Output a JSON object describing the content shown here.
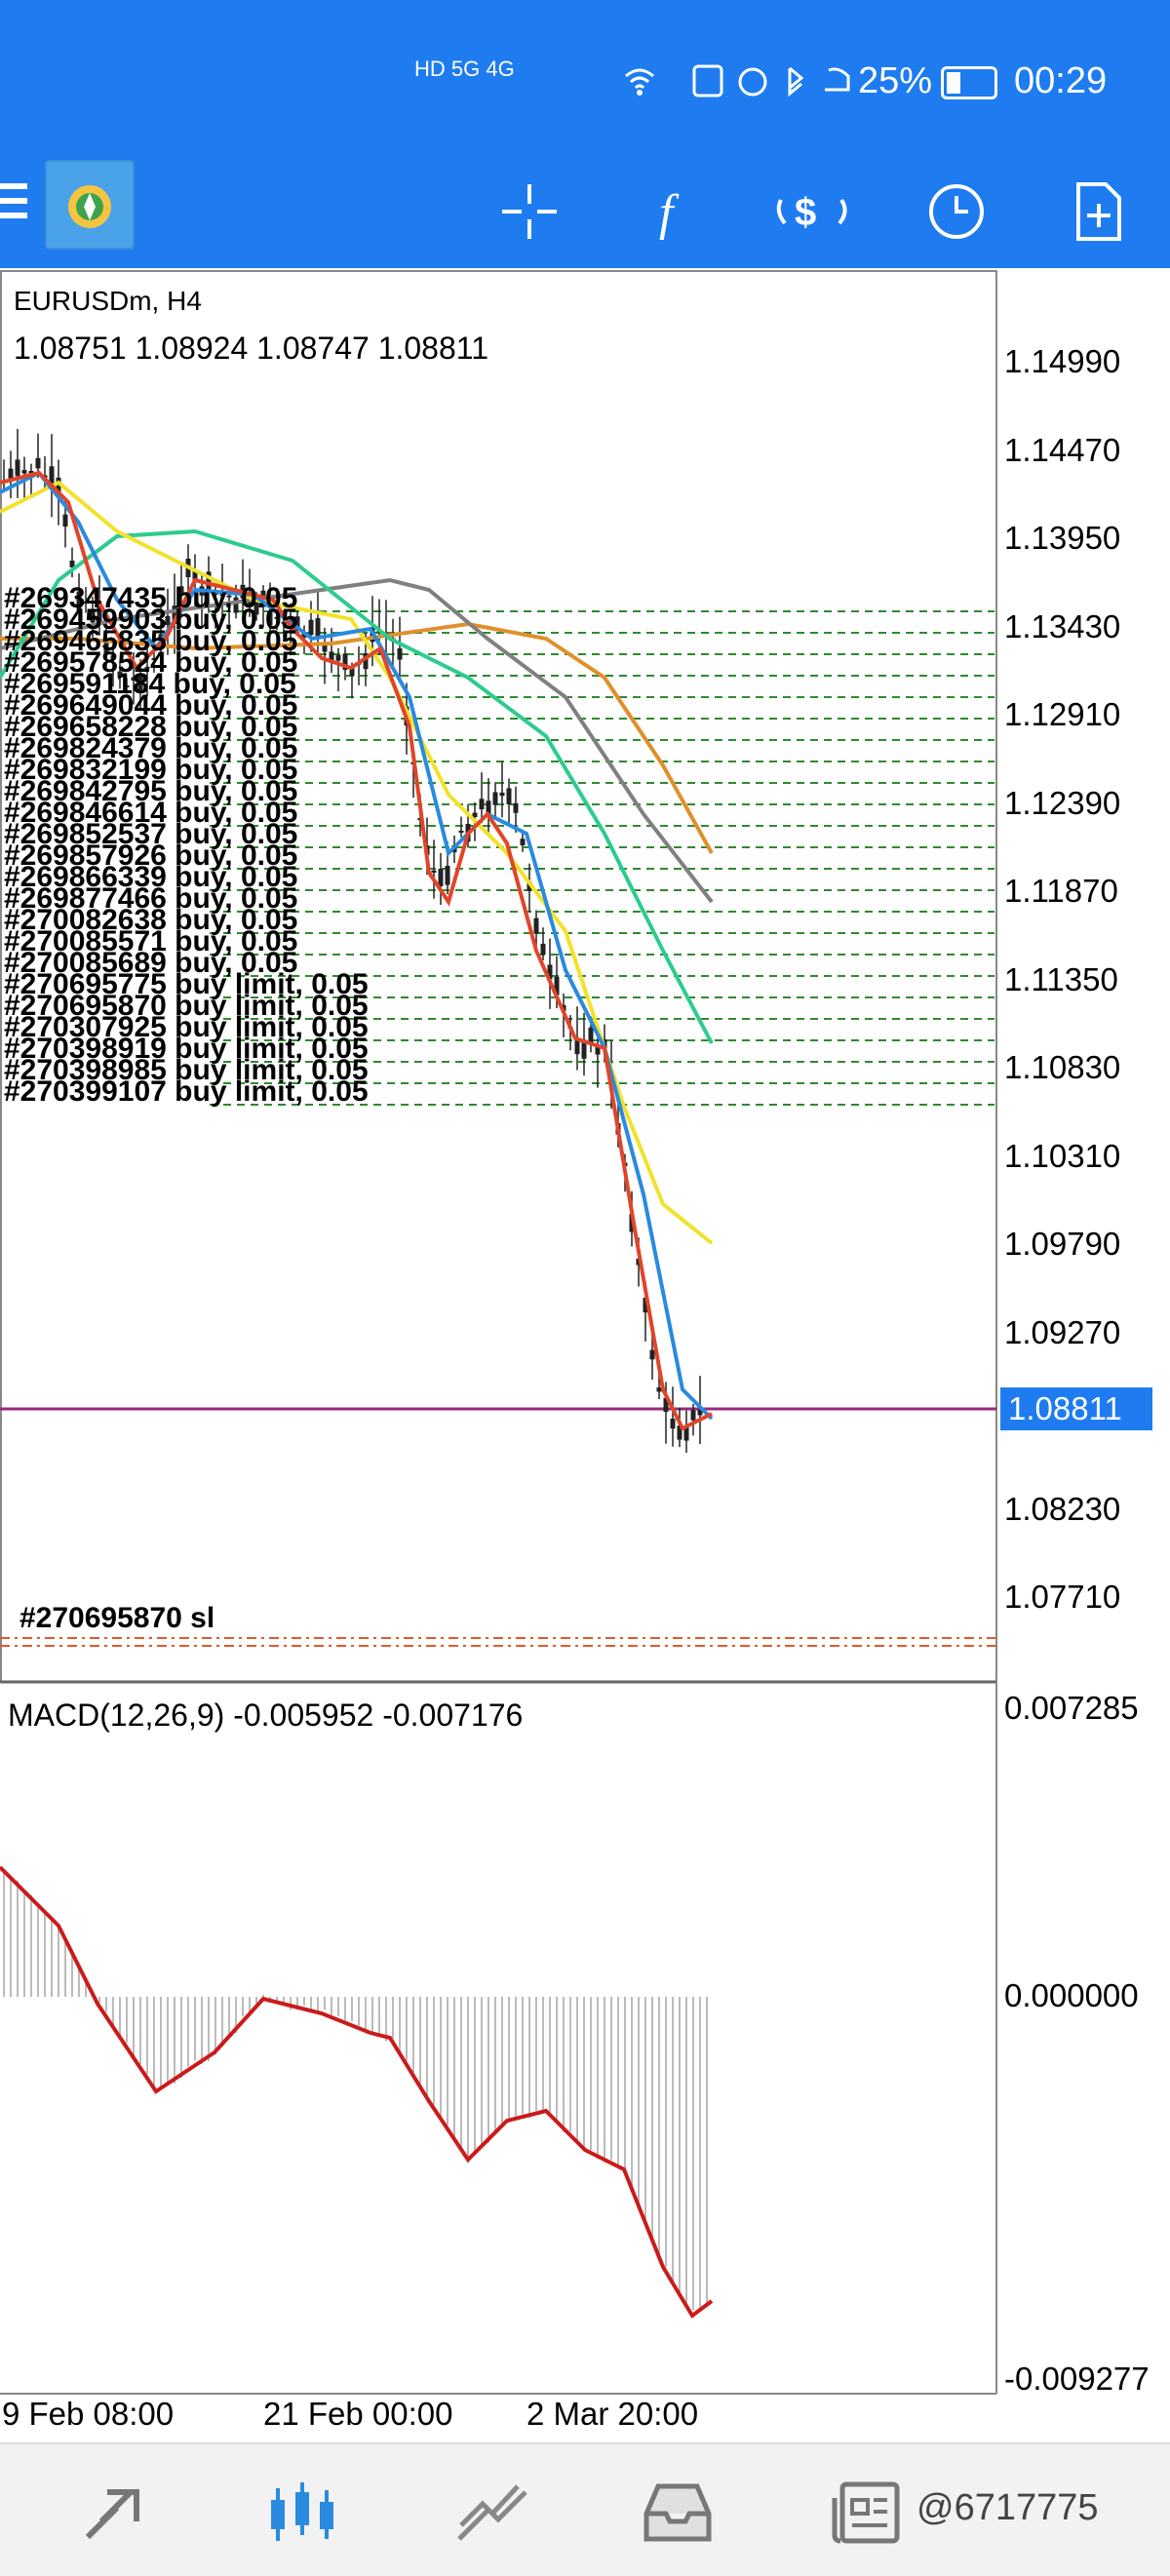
{
  "status_bar": {
    "network": "HD 5G 4G",
    "battery": "25%",
    "time": "00:29"
  },
  "toolbar": {
    "icons": [
      "menu-icon",
      "metatrader-logo",
      "crosshair-icon",
      "function-icon",
      "objects-icon",
      "period-clock-icon",
      "new-order-icon"
    ]
  },
  "chart": {
    "symbol_title": "EURUSDm, H4",
    "ohlc": "1.08751 1.08924 1.08747 1.08811",
    "current_price": "1.08811",
    "price_axis": [
      "1.14990",
      "1.14470",
      "1.13950",
      "1.13430",
      "1.12910",
      "1.12390",
      "1.11870",
      "1.11350",
      "1.10830",
      "1.10310",
      "1.09790",
      "1.09270",
      "1.08230",
      "1.07710"
    ],
    "orders": [
      "#269347435 buy, 0.05",
      "#269459903 buy, 0.05",
      "#269465835 buy, 0.05",
      "#269578524 buy, 0.05",
      "#269591184 buy, 0.05",
      "#269649044 buy, 0.05",
      "#269658228 buy, 0.05",
      "#269824379 buy, 0.05",
      "#269832199 buy, 0.05",
      "#269842795 buy, 0.05",
      "#269846614 buy, 0.05",
      "#269852537 buy, 0.05",
      "#269857926 buy, 0.05",
      "#269866339 buy, 0.05",
      "#269877466 buy, 0.05",
      "#270082638 buy, 0.05",
      "#270085571 buy, 0.05",
      "#270085689 buy, 0.05",
      "#270695775 buy limit, 0.05",
      "#270695870 buy limit, 0.05",
      "#270307925 buy limit, 0.05",
      "#270398919 buy limit, 0.05",
      "#270398985 buy limit, 0.05",
      "#270399107 buy limit, 0.05"
    ],
    "sl_label": "#270695870 sl"
  },
  "macd": {
    "title": "MACD(12,26,9) -0.005952 -0.007176",
    "axis": [
      "0.007285",
      "0.000000",
      "-0.009277"
    ]
  },
  "time_axis": [
    "9 Feb 08:00",
    "21 Feb 00:00",
    "2 Mar 20:00"
  ],
  "bottom_nav": {
    "icons": [
      "quotes-icon",
      "chart-icon",
      "trade-icon",
      "history-icon",
      "news-icon"
    ],
    "watermark": "@6717775"
  },
  "colors": {
    "accent": "#1e7cf0",
    "ma_fast": "#e0452a",
    "ma_blue": "#2a8ae0",
    "ma_yellow": "#f2e22a",
    "ma_green": "#2ccc8e",
    "ma_gray": "#808080",
    "ma_orange": "#e0902a",
    "macd_signal": "#cc1a1a",
    "order_line": "#2e8a2e",
    "sl_line": "#e05a2a",
    "price_line": "#9a2a7a"
  }
}
